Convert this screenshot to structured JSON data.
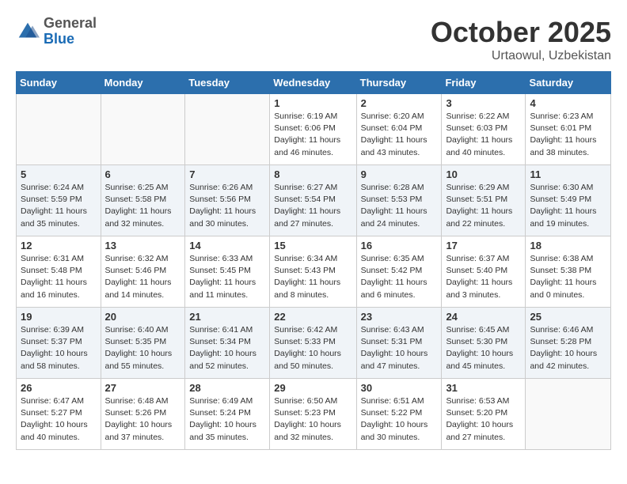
{
  "header": {
    "logo": {
      "general": "General",
      "blue": "Blue"
    },
    "title": "October 2025",
    "location": "Urtaowul, Uzbekistan"
  },
  "weekdays": [
    "Sunday",
    "Monday",
    "Tuesday",
    "Wednesday",
    "Thursday",
    "Friday",
    "Saturday"
  ],
  "weeks": [
    [
      {
        "day": "",
        "info": ""
      },
      {
        "day": "",
        "info": ""
      },
      {
        "day": "",
        "info": ""
      },
      {
        "day": "1",
        "info": "Sunrise: 6:19 AM\nSunset: 6:06 PM\nDaylight: 11 hours\nand 46 minutes."
      },
      {
        "day": "2",
        "info": "Sunrise: 6:20 AM\nSunset: 6:04 PM\nDaylight: 11 hours\nand 43 minutes."
      },
      {
        "day": "3",
        "info": "Sunrise: 6:22 AM\nSunset: 6:03 PM\nDaylight: 11 hours\nand 40 minutes."
      },
      {
        "day": "4",
        "info": "Sunrise: 6:23 AM\nSunset: 6:01 PM\nDaylight: 11 hours\nand 38 minutes."
      }
    ],
    [
      {
        "day": "5",
        "info": "Sunrise: 6:24 AM\nSunset: 5:59 PM\nDaylight: 11 hours\nand 35 minutes."
      },
      {
        "day": "6",
        "info": "Sunrise: 6:25 AM\nSunset: 5:58 PM\nDaylight: 11 hours\nand 32 minutes."
      },
      {
        "day": "7",
        "info": "Sunrise: 6:26 AM\nSunset: 5:56 PM\nDaylight: 11 hours\nand 30 minutes."
      },
      {
        "day": "8",
        "info": "Sunrise: 6:27 AM\nSunset: 5:54 PM\nDaylight: 11 hours\nand 27 minutes."
      },
      {
        "day": "9",
        "info": "Sunrise: 6:28 AM\nSunset: 5:53 PM\nDaylight: 11 hours\nand 24 minutes."
      },
      {
        "day": "10",
        "info": "Sunrise: 6:29 AM\nSunset: 5:51 PM\nDaylight: 11 hours\nand 22 minutes."
      },
      {
        "day": "11",
        "info": "Sunrise: 6:30 AM\nSunset: 5:49 PM\nDaylight: 11 hours\nand 19 minutes."
      }
    ],
    [
      {
        "day": "12",
        "info": "Sunrise: 6:31 AM\nSunset: 5:48 PM\nDaylight: 11 hours\nand 16 minutes."
      },
      {
        "day": "13",
        "info": "Sunrise: 6:32 AM\nSunset: 5:46 PM\nDaylight: 11 hours\nand 14 minutes."
      },
      {
        "day": "14",
        "info": "Sunrise: 6:33 AM\nSunset: 5:45 PM\nDaylight: 11 hours\nand 11 minutes."
      },
      {
        "day": "15",
        "info": "Sunrise: 6:34 AM\nSunset: 5:43 PM\nDaylight: 11 hours\nand 8 minutes."
      },
      {
        "day": "16",
        "info": "Sunrise: 6:35 AM\nSunset: 5:42 PM\nDaylight: 11 hours\nand 6 minutes."
      },
      {
        "day": "17",
        "info": "Sunrise: 6:37 AM\nSunset: 5:40 PM\nDaylight: 11 hours\nand 3 minutes."
      },
      {
        "day": "18",
        "info": "Sunrise: 6:38 AM\nSunset: 5:38 PM\nDaylight: 11 hours\nand 0 minutes."
      }
    ],
    [
      {
        "day": "19",
        "info": "Sunrise: 6:39 AM\nSunset: 5:37 PM\nDaylight: 10 hours\nand 58 minutes."
      },
      {
        "day": "20",
        "info": "Sunrise: 6:40 AM\nSunset: 5:35 PM\nDaylight: 10 hours\nand 55 minutes."
      },
      {
        "day": "21",
        "info": "Sunrise: 6:41 AM\nSunset: 5:34 PM\nDaylight: 10 hours\nand 52 minutes."
      },
      {
        "day": "22",
        "info": "Sunrise: 6:42 AM\nSunset: 5:33 PM\nDaylight: 10 hours\nand 50 minutes."
      },
      {
        "day": "23",
        "info": "Sunrise: 6:43 AM\nSunset: 5:31 PM\nDaylight: 10 hours\nand 47 minutes."
      },
      {
        "day": "24",
        "info": "Sunrise: 6:45 AM\nSunset: 5:30 PM\nDaylight: 10 hours\nand 45 minutes."
      },
      {
        "day": "25",
        "info": "Sunrise: 6:46 AM\nSunset: 5:28 PM\nDaylight: 10 hours\nand 42 minutes."
      }
    ],
    [
      {
        "day": "26",
        "info": "Sunrise: 6:47 AM\nSunset: 5:27 PM\nDaylight: 10 hours\nand 40 minutes."
      },
      {
        "day": "27",
        "info": "Sunrise: 6:48 AM\nSunset: 5:26 PM\nDaylight: 10 hours\nand 37 minutes."
      },
      {
        "day": "28",
        "info": "Sunrise: 6:49 AM\nSunset: 5:24 PM\nDaylight: 10 hours\nand 35 minutes."
      },
      {
        "day": "29",
        "info": "Sunrise: 6:50 AM\nSunset: 5:23 PM\nDaylight: 10 hours\nand 32 minutes."
      },
      {
        "day": "30",
        "info": "Sunrise: 6:51 AM\nSunset: 5:22 PM\nDaylight: 10 hours\nand 30 minutes."
      },
      {
        "day": "31",
        "info": "Sunrise: 6:53 AM\nSunset: 5:20 PM\nDaylight: 10 hours\nand 27 minutes."
      },
      {
        "day": "",
        "info": ""
      }
    ]
  ]
}
